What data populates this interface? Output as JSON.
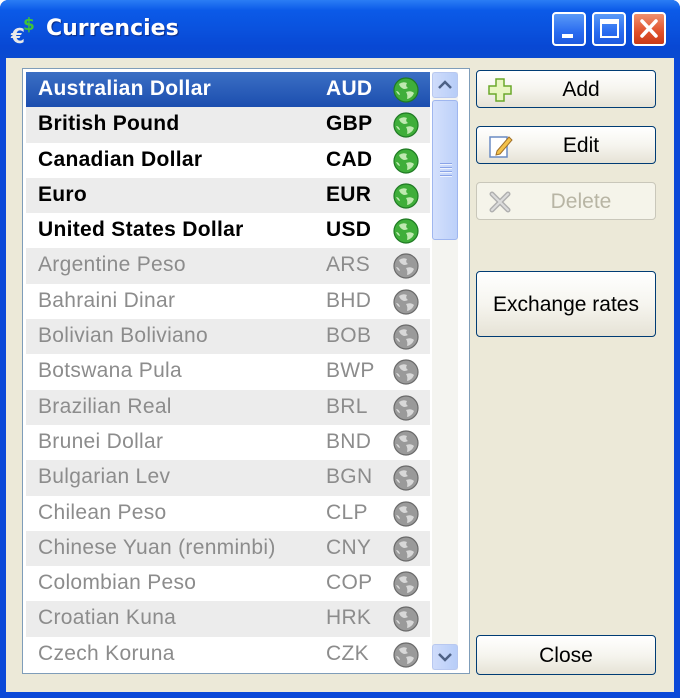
{
  "window": {
    "title": "Currencies",
    "icon": "euro-dollar-icon"
  },
  "titlebar_buttons": [
    "minimize-icon",
    "maximize-icon",
    "close-icon"
  ],
  "currencies": [
    {
      "name": "Australian Dollar",
      "code": "AUD",
      "active": true,
      "selected": true
    },
    {
      "name": "British Pound",
      "code": "GBP",
      "active": true,
      "selected": false
    },
    {
      "name": "Canadian Dollar",
      "code": "CAD",
      "active": true,
      "selected": false
    },
    {
      "name": "Euro",
      "code": "EUR",
      "active": true,
      "selected": false
    },
    {
      "name": "United States Dollar",
      "code": "USD",
      "active": true,
      "selected": false
    },
    {
      "name": "Argentine Peso",
      "code": "ARS",
      "active": false,
      "selected": false
    },
    {
      "name": "Bahraini Dinar",
      "code": "BHD",
      "active": false,
      "selected": false
    },
    {
      "name": "Bolivian Boliviano",
      "code": "BOB",
      "active": false,
      "selected": false
    },
    {
      "name": "Botswana Pula",
      "code": "BWP",
      "active": false,
      "selected": false
    },
    {
      "name": "Brazilian Real",
      "code": "BRL",
      "active": false,
      "selected": false
    },
    {
      "name": "Brunei Dollar",
      "code": "BND",
      "active": false,
      "selected": false
    },
    {
      "name": "Bulgarian Lev",
      "code": "BGN",
      "active": false,
      "selected": false
    },
    {
      "name": "Chilean Peso",
      "code": "CLP",
      "active": false,
      "selected": false
    },
    {
      "name": "Chinese Yuan (renminbi)",
      "code": "CNY",
      "active": false,
      "selected": false
    },
    {
      "name": "Colombian Peso",
      "code": "COP",
      "active": false,
      "selected": false
    },
    {
      "name": "Croatian Kuna",
      "code": "HRK",
      "active": false,
      "selected": false
    },
    {
      "name": "Czech Koruna",
      "code": "CZK",
      "active": false,
      "selected": false
    }
  ],
  "buttons": {
    "add": "Add",
    "edit": "Edit",
    "delete": "Delete",
    "exchange_rates": "Exchange rates",
    "close": "Close"
  },
  "colors": {
    "selection": "#1c4eaf",
    "active_globe": "#3fae3a",
    "inactive_globe": "#9a9a9a",
    "titlebar": "#0a52de"
  }
}
